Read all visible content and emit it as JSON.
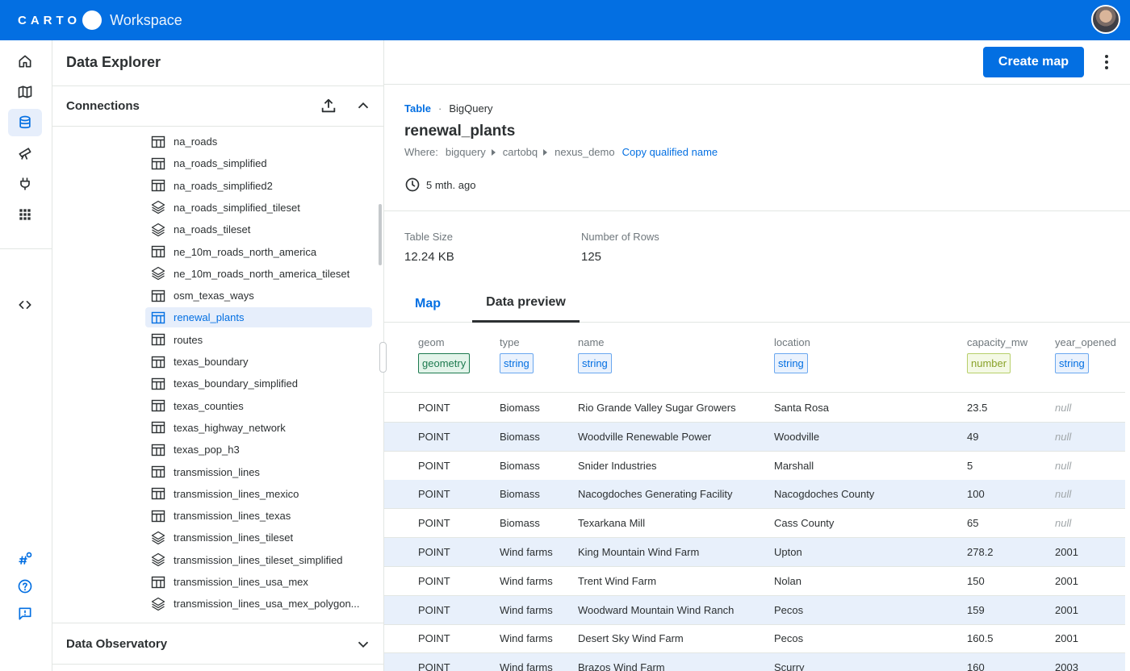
{
  "app": {
    "brand": "CARTO",
    "product": "Workspace"
  },
  "explorer": {
    "title": "Data Explorer",
    "connections_label": "Connections",
    "observatory_label": "Data Observatory",
    "tree": [
      {
        "label": "na_roads",
        "kind": "table"
      },
      {
        "label": "na_roads_simplified",
        "kind": "table"
      },
      {
        "label": "na_roads_simplified2",
        "kind": "table"
      },
      {
        "label": "na_roads_simplified_tileset",
        "kind": "tileset"
      },
      {
        "label": "na_roads_tileset",
        "kind": "tileset"
      },
      {
        "label": "ne_10m_roads_north_america",
        "kind": "table"
      },
      {
        "label": "ne_10m_roads_north_america_tileset",
        "kind": "tileset"
      },
      {
        "label": "osm_texas_ways",
        "kind": "table"
      },
      {
        "label": "renewal_plants",
        "kind": "table",
        "selected": true
      },
      {
        "label": "routes",
        "kind": "table"
      },
      {
        "label": "texas_boundary",
        "kind": "table"
      },
      {
        "label": "texas_boundary_simplified",
        "kind": "table"
      },
      {
        "label": "texas_counties",
        "kind": "table"
      },
      {
        "label": "texas_highway_network",
        "kind": "table"
      },
      {
        "label": "texas_pop_h3",
        "kind": "table"
      },
      {
        "label": "transmission_lines",
        "kind": "table"
      },
      {
        "label": "transmission_lines_mexico",
        "kind": "table"
      },
      {
        "label": "transmission_lines_texas",
        "kind": "table"
      },
      {
        "label": "transmission_lines_tileset",
        "kind": "tileset"
      },
      {
        "label": "transmission_lines_tileset_simplified",
        "kind": "tileset"
      },
      {
        "label": "transmission_lines_usa_mex",
        "kind": "table"
      },
      {
        "label": "transmission_lines_usa_mex_polygon...",
        "kind": "tileset"
      }
    ]
  },
  "main": {
    "create_map_label": "Create map",
    "breadcrumb": {
      "type": "Table",
      "separator": "·",
      "source": "BigQuery"
    },
    "table_name": "renewal_plants",
    "where": {
      "label": "Where:",
      "path": [
        "bigquery",
        "cartobq",
        "nexus_demo"
      ],
      "copy_label": "Copy qualified name"
    },
    "updated": "5 mth. ago",
    "stats": {
      "size_label": "Table Size",
      "size_value": "12.24 KB",
      "rows_label": "Number of Rows",
      "rows_value": "125"
    },
    "tabs": {
      "map": "Map",
      "preview": "Data preview"
    },
    "columns": [
      {
        "name": "geom",
        "type": "geometry"
      },
      {
        "name": "type",
        "type": "string"
      },
      {
        "name": "name",
        "type": "string"
      },
      {
        "name": "location",
        "type": "string"
      },
      {
        "name": "capacity_mw",
        "type": "number"
      },
      {
        "name": "year_opened",
        "type": "string"
      }
    ],
    "rows": [
      [
        "POINT",
        "Biomass",
        "Rio Grande Valley Sugar Growers",
        "Santa Rosa",
        "23.5",
        "null"
      ],
      [
        "POINT",
        "Biomass",
        "Woodville Renewable Power",
        "Woodville",
        "49",
        "null"
      ],
      [
        "POINT",
        "Biomass",
        "Snider Industries",
        "Marshall",
        "5",
        "null"
      ],
      [
        "POINT",
        "Biomass",
        "Nacogdoches Generating Facility",
        "Nacogdoches County",
        "100",
        "null"
      ],
      [
        "POINT",
        "Biomass",
        "Texarkana Mill",
        "Cass County",
        "65",
        "null"
      ],
      [
        "POINT",
        "Wind farms",
        "King Mountain Wind Farm",
        "Upton",
        "278.2",
        "2001"
      ],
      [
        "POINT",
        "Wind farms",
        "Trent Wind Farm",
        "Nolan",
        "150",
        "2001"
      ],
      [
        "POINT",
        "Wind farms",
        "Woodward Mountain Wind Ranch",
        "Pecos",
        "159",
        "2001"
      ],
      [
        "POINT",
        "Wind farms",
        "Desert Sky Wind Farm",
        "Pecos",
        "160.5",
        "2001"
      ],
      [
        "POINT",
        "Wind farms",
        "Brazos Wind Farm",
        "Scurry",
        "160",
        "2003"
      ]
    ]
  },
  "colors": {
    "brand_blue": "#036fe2",
    "row_alt": "#e8f0fb"
  },
  "icons": {
    "rail": [
      "home-icon",
      "map-icon",
      "database-icon",
      "telescope-icon",
      "plug-icon",
      "apps-grid-icon",
      "code-icon",
      "hashtag-settings-icon",
      "help-icon",
      "feedback-icon"
    ]
  }
}
